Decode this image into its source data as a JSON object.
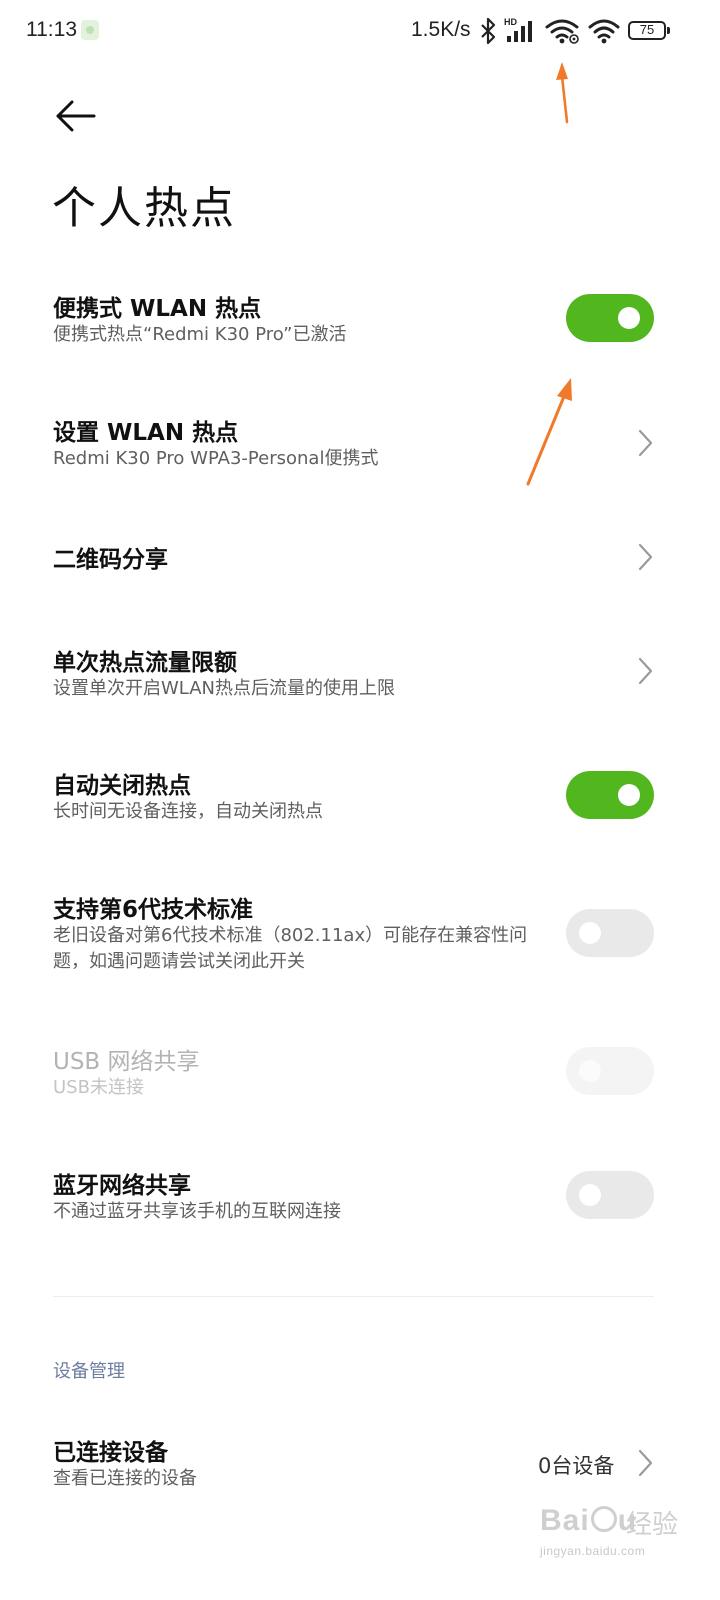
{
  "status_bar": {
    "time": "11:13",
    "network_speed": "1.5K/s",
    "battery_level": "75",
    "icons": [
      "app-notification-icon",
      "bluetooth-icon",
      "hd-signal-icon",
      "wifi-hotspot-icon",
      "wifi-icon",
      "battery-icon"
    ]
  },
  "header": {
    "back_icon": "arrow-left-icon",
    "title": "个人热点"
  },
  "settings": {
    "portable_hotspot": {
      "title": "便携式 WLAN 热点",
      "subtitle": "便携式热点“Redmi K30 Pro”已激活",
      "enabled": true
    },
    "setup_hotspot": {
      "title": "设置 WLAN 热点",
      "subtitle": "Redmi K30 Pro WPA3-Personal便携式"
    },
    "qr_share": {
      "title": "二维码分享"
    },
    "data_limit": {
      "title": "单次热点流量限额",
      "subtitle": "设置单次开启WLAN热点后流量的使用上限"
    },
    "auto_off": {
      "title": "自动关闭热点",
      "subtitle": "长时间无设备连接，自动关闭热点",
      "enabled": true
    },
    "wifi6": {
      "title": "支持第6代技术标准",
      "subtitle": "老旧设备对第6代技术标准（802.11ax）可能存在兼容性问题，如遇问题请尝试关闭此开关",
      "enabled": false
    },
    "usb_tethering": {
      "title": "USB 网络共享",
      "subtitle": "USB未连接",
      "enabled": false,
      "disabled": true
    },
    "bluetooth_tethering": {
      "title": "蓝牙网络共享",
      "subtitle": "不通过蓝牙共享该手机的互联网连接",
      "enabled": false
    }
  },
  "device_section": {
    "header": "设备管理",
    "connected_devices": {
      "title": "已连接设备",
      "subtitle": "查看已连接的设备",
      "count": "0台设备"
    }
  },
  "watermark": {
    "logo_text": "Baidu",
    "cn_text": "经验",
    "url": "jingyan.baidu.com"
  },
  "colors": {
    "toggle_on": "#52b61e",
    "toggle_off": "#e9e9e9",
    "annotation_arrow": "#f07a2a",
    "section_header": "#6b7ea0"
  }
}
